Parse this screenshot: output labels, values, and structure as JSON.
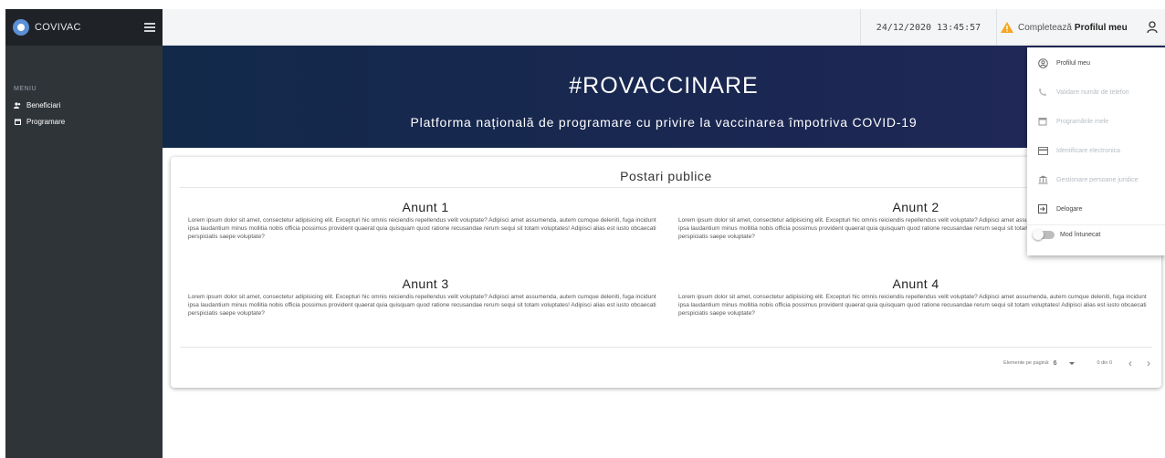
{
  "app": {
    "title": "COVIVAC"
  },
  "sidebar": {
    "menu_title": "MENIU",
    "items": [
      {
        "label": "Beneficiari",
        "icon": "users-icon"
      },
      {
        "label": "Programare",
        "icon": "calendar-icon"
      }
    ]
  },
  "topbar": {
    "datetime": "24/12/2020 13:45:57",
    "complete_prefix": "Completează",
    "complete_link": "Profilul meu"
  },
  "banner": {
    "title": "#ROVACCINARE",
    "subtitle": "Platforma națională de programare cu privire la vaccinarea împotriva COVID-19"
  },
  "posts": {
    "title": "Postari publice",
    "items": [
      {
        "title": "Anunt 1",
        "body": "Lorem ipsum dolor sit amet, consectetur adipisicing elit. Excepturi hic omnis reiciendis repellendus velit voluptate? Adipisci amet assumenda, autem cumque deleniti, fuga incidunt ipsa laudantium minus mollitia nobis officia possimus provident quaerat quia quisquam quod ratione recusandae rerum sequi sit totam voluptates! Adipisci alias est iusto obcaecati perspiciatis saepe voluptate?"
      },
      {
        "title": "Anunt 2",
        "body": "Lorem ipsum dolor sit amet, consectetur adipisicing elit. Excepturi hic omnis reiciendis repellendus velit voluptate? Adipisci amet assumenda, autem cumque deleniti, fuga incidunt ipsa laudantium minus mollitia nobis officia possimus provident quaerat quia quisquam quod ratione recusandae rerum sequi sit totam voluptates! Adipisci alias est iusto obcaecati perspiciatis saepe voluptate?"
      },
      {
        "title": "Anunt 3",
        "body": "Lorem ipsum dolor sit amet, consectetur adipisicing elit. Excepturi hic omnis reiciendis repellendus velit voluptate? Adipisci amet assumenda, autem cumque deleniti, fuga incidunt ipsa laudantium minus mollitia nobis officia possimus provident quaerat quia quisquam quod ratione recusandae rerum sequi sit totam voluptates! Adipisci alias est iusto obcaecati perspiciatis saepe voluptate?"
      },
      {
        "title": "Anunt 4",
        "body": "Lorem ipsum dolor sit amet, consectetur adipisicing elit. Excepturi hic omnis reiciendis repellendus velit voluptate? Adipisci amet assumenda, autem cumque deleniti, fuga incidunt ipsa laudantium minus mollitia nobis officia possimus provident quaerat quia quisquam quod ratione recusandae rerum sequi sit totam voluptates! Adipisci alias est iusto obcaecati perspiciatis saepe voluptate?"
      }
    ],
    "pager": {
      "items_per_page_label": "Elemente pe pagină:",
      "items_per_page": "6",
      "range": "0 din 0",
      "prev_glyph": "‹",
      "next_glyph": "›"
    }
  },
  "profile_menu": {
    "items": [
      {
        "label": "Profilul meu",
        "icon": "account-circle-icon",
        "enabled": true
      },
      {
        "label": "Validare număr de telefon",
        "icon": "phone-icon",
        "enabled": false
      },
      {
        "label": "Programările mele",
        "icon": "calendar-icon",
        "enabled": false
      },
      {
        "label": "Identificare electronica",
        "icon": "credit-card-icon",
        "enabled": false
      },
      {
        "label": "Gestionare persoane juridice",
        "icon": "bank-icon",
        "enabled": false
      },
      {
        "label": "Delogare",
        "icon": "logout-icon",
        "enabled": true
      }
    ],
    "dark_mode_label": "Mod întunecat"
  },
  "colors": {
    "sidebar_bg": "#2f3439",
    "banner_bg": "#1a2750",
    "warning": "#f5a623",
    "accent": "#5b8fd6"
  }
}
